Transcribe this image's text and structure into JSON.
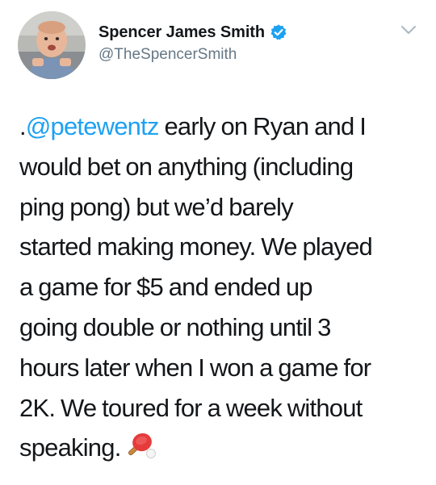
{
  "author": {
    "display_name": "Spencer James Smith",
    "handle": "@TheSpencerSmith",
    "verified": true,
    "avatar_icon": "baby-photo-avatar"
  },
  "menu_icon": "chevron-down-icon",
  "tweet": {
    "mention_prefix": ".",
    "mention": "@petewentz",
    "line1_rest": " early on Ryan and I",
    "line2": "would bet on anything (including",
    "line3": "ping pong) but we’d barely",
    "line4": "started making money. We played",
    "line5": "a game for $5 and ended up",
    "line6": "going double or nothing until 3",
    "line7": "hours later when I won a game for",
    "line8": "2K. We toured for a week without",
    "line9": "speaking.",
    "emoji": "ping-pong-emoji"
  },
  "colors": {
    "link": "#1da1f2",
    "text": "#14171a",
    "secondary": "#657786",
    "verified_badge": "#1da1f2"
  }
}
